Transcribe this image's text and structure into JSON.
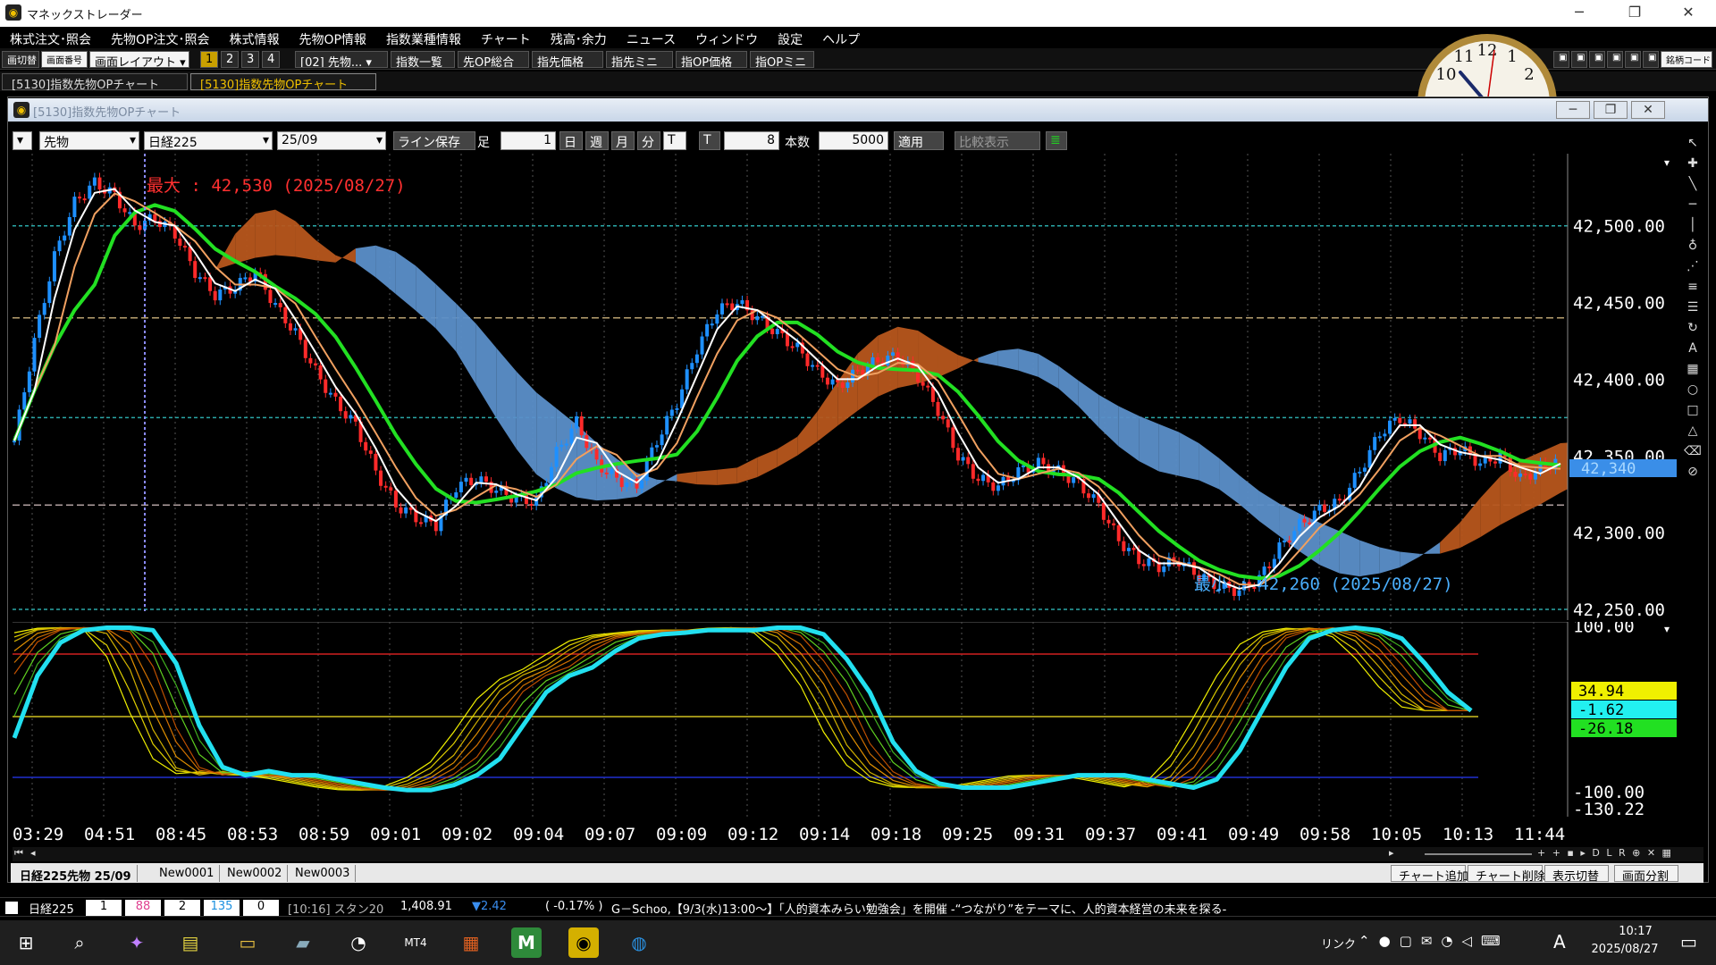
{
  "titlebar": {
    "title": "マネックストレーダー"
  },
  "menu": [
    "株式注文･照会",
    "先物OP注文･照会",
    "株式情報",
    "先物OP情報",
    "指数業種情報",
    "チャート",
    "残高･余力",
    "ニュース",
    "ウィンドウ",
    "設定",
    "ヘルプ"
  ],
  "toolbar": {
    "switch": "画切替",
    "screen_no": "画面番号",
    "layout": "画面レイアウト",
    "pages": [
      "1",
      "2",
      "3",
      "4"
    ],
    "preset": "[02] 先物...",
    "buttons": [
      "指数一覧",
      "先OP総合",
      "指先価格",
      "指先ミニ",
      "指OP価格",
      "指OPミニ"
    ],
    "code_placeholder": "銘柄コード"
  },
  "tabs": [
    "[5130]指数先物OPチャート",
    "[5130]指数先物OPチャート"
  ],
  "window": {
    "title": "[5130]指数先物OPチャート"
  },
  "controls": {
    "type": "先物",
    "index": "日経225",
    "month": "25/09",
    "line_save": "ライン保存",
    "foot_label": "足",
    "foot_value": "1",
    "periods": [
      "日",
      "週",
      "月",
      "分",
      "T"
    ],
    "t_label": "T",
    "t_value": "8",
    "count_label": "本数",
    "count_value": "5000",
    "apply": "適用",
    "compare": "比較表示"
  },
  "chart_data": [
    {
      "type": "line",
      "title": "",
      "y_ticks": [
        "42,500.00",
        "42,450.00",
        "42,400.00",
        "42,350.00",
        "42,300.00",
        "42,250.00"
      ],
      "ylim": [
        42243,
        42547
      ],
      "last_price": "42,340",
      "annotations": {
        "max": "最大 : 42,530 (2025/08/27)",
        "min": "最小 : 42,260 (2025/08/27)"
      },
      "series": [
        {
          "values": [
            42360,
            42425,
            42480,
            42515,
            42528,
            42520,
            42500,
            42505,
            42495,
            42470,
            42455,
            42460,
            42470,
            42448,
            42430,
            42405,
            42385,
            42370,
            42340,
            42318,
            42310,
            42305,
            42330,
            42335,
            42328,
            42322,
            42320,
            42352,
            42372,
            42345,
            42335,
            42330,
            42360,
            42385,
            42420,
            42445,
            42450,
            42440,
            42430,
            42420,
            42405,
            42395,
            42405,
            42412,
            42415,
            42402,
            42380,
            42350,
            42335,
            42330,
            42340,
            42345,
            42340,
            42332,
            42318,
            42295,
            42282,
            42278,
            42282,
            42272,
            42265,
            42262,
            42270,
            42290,
            42305,
            42315,
            42320,
            42340,
            42365,
            42375,
            42365,
            42350,
            42355,
            42345,
            42350,
            42335,
            42342,
            42348
          ]
        }
      ]
    },
    {
      "type": "line",
      "title": "",
      "y_ticks": [
        "100.00",
        "-100.00",
        "-130.22"
      ],
      "ylim": [
        -130,
        105
      ],
      "readouts": [
        "34.94",
        "-1.62",
        "-26.18"
      ],
      "series": [
        {
          "values": [
            -35,
            40,
            80,
            95,
            98,
            98,
            95,
            55,
            -20,
            -70,
            -80,
            -75,
            -80,
            -80,
            -85,
            -90,
            -95,
            -98,
            -98,
            -92,
            -80,
            -60,
            -20,
            20,
            40,
            50,
            70,
            85,
            90,
            92,
            95,
            95,
            95,
            98,
            98,
            90,
            60,
            20,
            -40,
            -75,
            -90,
            -95,
            -95,
            -95,
            -90,
            -85,
            -80,
            -80,
            -80,
            -85,
            -90,
            -95,
            -85,
            -50,
            0,
            50,
            85,
            95,
            98,
            95,
            85,
            55,
            20,
            -2
          ]
        }
      ]
    }
  ],
  "time_labels": [
    "03:29",
    "04:51",
    "08:45",
    "08:53",
    "08:59",
    "09:01",
    "09:02",
    "09:04",
    "09:07",
    "09:09",
    "09:12",
    "09:14",
    "09:18",
    "09:25",
    "09:31",
    "09:37",
    "09:41",
    "09:49",
    "09:58",
    "10:05",
    "10:13",
    "11:44"
  ],
  "bottom_tabs": [
    "日経225先物 25/09",
    "New0001",
    "New0002",
    "New0003"
  ],
  "bottom_buttons": [
    "チャート追加",
    "チャート削除",
    "表示切替",
    "画面分割"
  ],
  "ticker": {
    "name": "日経225",
    "c1": "1",
    "c2": "88",
    "c3": "2",
    "c4": "135",
    "c5": "0",
    "time": "[10:16] スタン20",
    "price": "1,408.91",
    "change": "▼2.42",
    "pct": "( -0.17% )",
    "news": "G－Schoo,【9/3(水)13:00～】「人的資本みらい勉強会」を開催 -“つながり”をテーマに、人的資本経営の未来を探る-"
  },
  "taskbar": {
    "link": "リンク",
    "ime": "A",
    "time": "10:17",
    "date": "2025/08/27"
  },
  "colors": {
    "up": "#1e90ff",
    "down": "#ff2a2a",
    "cloud_blue": "#5b8fc9",
    "cloud_orange": "#b7561c",
    "ma_green": "#22e022",
    "osc_cyan": "#22e0f0"
  }
}
